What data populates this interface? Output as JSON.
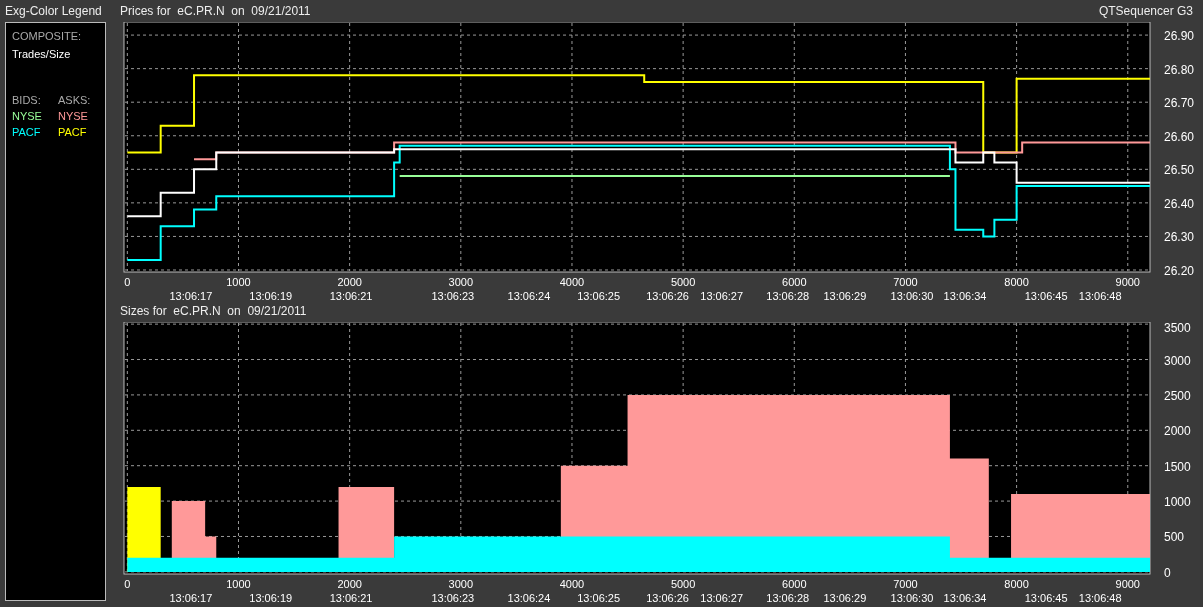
{
  "legend": {
    "title": "Exg-Color Legend",
    "composite_label": "COMPOSITE:",
    "composite_item": "Trades/Size",
    "bids_label": "BIDS:",
    "asks_label": "ASKS:",
    "bids": [
      {
        "label": "NYSE",
        "color": "#99ff99"
      },
      {
        "label": "PACF",
        "color": "#00ffff"
      }
    ],
    "asks": [
      {
        "label": "NYSE",
        "color": "#ff9999"
      },
      {
        "label": "PACF",
        "color": "#ffff00"
      }
    ]
  },
  "prices_panel": {
    "title": "Prices for  eC.PR.N  on  09/21/2011",
    "app_name": "QTSequencer G3",
    "chart_data": {
      "type": "line",
      "grid": true,
      "x": [
        0,
        300,
        300,
        600,
        600,
        800,
        800,
        2400,
        2400,
        2450,
        2450,
        4650,
        4650,
        7400,
        7400,
        7450,
        7450,
        7700,
        7700,
        7800,
        7800,
        8000,
        8000,
        8050,
        8050,
        9200,
        9200
      ],
      "series": [
        {
          "color": "#ffff00",
          "values": [
            26.55,
            26.55,
            26.63,
            26.63,
            26.78,
            26.78,
            26.78,
            26.78,
            26.78,
            26.78,
            26.78,
            26.78,
            26.76,
            26.76,
            26.76,
            26.76,
            26.76,
            26.76,
            26.55,
            26.55,
            26.55,
            26.55,
            26.77,
            26.77,
            26.77,
            26.77,
            26.77
          ]
        },
        {
          "color": "#ff9999",
          "values": [
            null,
            null,
            null,
            null,
            26.53,
            26.53,
            26.55,
            26.55,
            26.58,
            26.58,
            26.58,
            26.58,
            26.58,
            26.58,
            26.58,
            26.58,
            26.55,
            26.55,
            26.55,
            26.55,
            26.55,
            26.55,
            26.55,
            26.55,
            26.58,
            26.58,
            26.58
          ]
        },
        {
          "color": "#99ff99",
          "values": [
            null,
            null,
            null,
            null,
            null,
            null,
            null,
            null,
            null,
            null,
            26.48,
            26.48,
            26.48,
            26.48,
            null,
            null,
            null,
            null,
            null,
            null,
            null,
            null,
            null,
            null,
            null,
            null,
            null
          ]
        },
        {
          "color": "#00ffff",
          "values": [
            26.23,
            26.23,
            26.33,
            26.33,
            26.38,
            26.38,
            26.42,
            26.42,
            26.52,
            26.52,
            26.57,
            26.57,
            26.57,
            26.57,
            26.5,
            26.5,
            26.32,
            26.32,
            26.3,
            26.3,
            26.35,
            26.35,
            26.45,
            26.45,
            26.45,
            26.45,
            26.45
          ]
        },
        {
          "color": "#ffffff",
          "values": [
            26.36,
            26.36,
            26.43,
            26.43,
            26.5,
            26.5,
            26.55,
            26.55,
            26.56,
            26.56,
            26.56,
            26.56,
            26.56,
            26.56,
            26.56,
            26.56,
            26.52,
            26.52,
            26.55,
            26.55,
            26.52,
            26.52,
            26.46,
            26.46,
            26.46,
            26.46,
            null
          ]
        }
      ],
      "xlim": [
        -30,
        9200
      ],
      "ylim": [
        26.194,
        26.939
      ],
      "xticks": [
        0,
        1000,
        2000,
        3000,
        4000,
        5000,
        6000,
        7000,
        8000,
        9000
      ],
      "yticks": [
        {
          "value": 26.2,
          "label": "26.20"
        },
        {
          "value": 26.3,
          "label": "26.30"
        },
        {
          "value": 26.4,
          "label": "26.40"
        },
        {
          "value": 26.5,
          "label": "26.50"
        },
        {
          "value": 26.6,
          "label": "26.60"
        },
        {
          "value": 26.7,
          "label": "26.70"
        },
        {
          "value": 26.8,
          "label": "26.80"
        },
        {
          "value": 26.9,
          "label": "26.90"
        }
      ]
    },
    "time_ticks": [
      "13:06:17",
      "13:06:19",
      "13:06:21",
      "13:06:23",
      "13:06:24",
      "13:06:25",
      "13:06:26",
      "13:06:27",
      "13:06:28",
      "13:06:29",
      "13:06:30",
      "13:06:34",
      "13:06:45",
      "13:06:48"
    ]
  },
  "sizes_panel": {
    "title": "Sizes for  eC.PR.N  on  09/21/2011",
    "chart_data": {
      "type": "area",
      "grid": true,
      "x": [
        0,
        300,
        400,
        700,
        800,
        1900,
        2400,
        3900,
        4500,
        7400,
        7750,
        7950,
        9200
      ],
      "series": [
        {
          "color": "#ffff00",
          "values": [
            1200,
            0,
            0,
            0,
            0,
            0,
            0,
            0,
            0,
            0,
            0,
            0,
            0
          ]
        },
        {
          "color": "#ff9999",
          "values": [
            0,
            0,
            1000,
            500,
            0,
            1200,
            0,
            1500,
            2500,
            1600,
            null,
            1100,
            1100
          ]
        },
        {
          "color": "#00ffff",
          "values": [
            200,
            200,
            200,
            200,
            200,
            200,
            500,
            500,
            500,
            200,
            200,
            200,
            200
          ]
        }
      ],
      "xlim": [
        -30,
        9200
      ],
      "ylim": [
        -30,
        3530
      ],
      "xticks": [
        0,
        1000,
        2000,
        3000,
        4000,
        5000,
        6000,
        7000,
        8000,
        9000
      ],
      "yticks": [
        0,
        500,
        1000,
        1500,
        2000,
        2500,
        3000,
        3500
      ]
    },
    "time_ticks": [
      "13:06:17",
      "13:06:19",
      "13:06:21",
      "13:06:23",
      "13:06:24",
      "13:06:25",
      "13:06:26",
      "13:06:27",
      "13:06:28",
      "13:06:29",
      "13:06:30",
      "13:06:34",
      "13:06:45",
      "13:06:48"
    ]
  }
}
